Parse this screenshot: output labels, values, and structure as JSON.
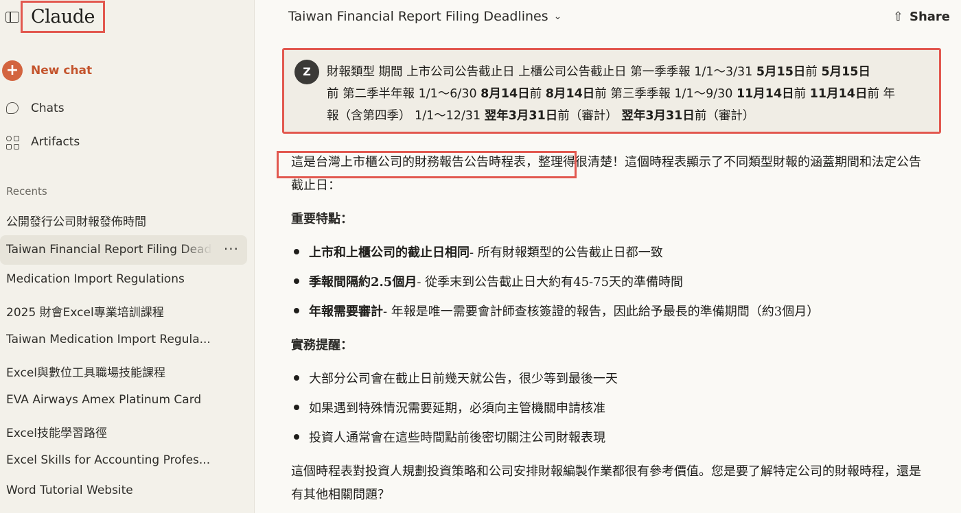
{
  "sidebar": {
    "brand": "Claude",
    "new_chat": "New chat",
    "nav": {
      "chats": "Chats",
      "artifacts": "Artifacts"
    },
    "recents_label": "Recents",
    "recents": [
      "公開發行公司財報發佈時間",
      "Taiwan Financial Report Filing Deadlines",
      "Medication Import Regulations",
      "2025 財會Excel專業培訓課程",
      "Taiwan Medication Import Regula...",
      "Excel與數位工具職場技能課程",
      "EVA Airways Amex Platinum Card",
      "Excel技能學習路徑",
      "Excel Skills for Accounting Profes...",
      "Word Tutorial Website"
    ],
    "active_more": "···"
  },
  "header": {
    "title": "Taiwan Financial Report Filing Deadlines",
    "share": "Share"
  },
  "user": {
    "avatar": "Z",
    "line1_a": "財報類型 期間 上市公司公告截止日 上櫃公司公告截止日 第一季季報 1/1～3/31 ",
    "line1_b1": "5月15日",
    "line1_c": "前 ",
    "line1_b2": "5月15日",
    "line2_a": "前 第二季半年報 1/1～6/30 ",
    "line2_b1": "8月14日",
    "line2_c": "前 ",
    "line2_b2": "8月14日",
    "line2_d": "前 第三季季報 1/1～9/30 ",
    "line2_b3": "11月14日",
    "line2_e": "前 ",
    "line2_b4": "11月14日",
    "line2_f": "前 年",
    "line3_a": "報（含第四季） 1/1～12/31 ",
    "line3_b1": "翌年3月31日",
    "line3_c": "前（審計） ",
    "line3_b2": "翌年3月31日",
    "line3_d": "前（審計）"
  },
  "response": {
    "para1": "這是台灣上市櫃公司的財務報告公告時程表，整理得很清楚！這個時程表顯示了不同類型財報的涵蓋期間和法定公告截止日：",
    "section1": "重要特點：",
    "bullets1": [
      {
        "bold": "上市和上櫃公司的截止日相同",
        "text": " - 所有財報類型的公告截止日都一致"
      },
      {
        "bold": "季報間隔約2.5個月",
        "text": " - 從季末到公告截止日大約有45-75天的準備時間"
      },
      {
        "bold": "年報需要審計",
        "text": " - 年報是唯一需要會計師查核簽證的報告，因此給予最長的準備期間（約3個月）"
      }
    ],
    "section2": "實務提醒：",
    "bullets2": [
      "大部分公司會在截止日前幾天就公告，很少等到最後一天",
      "如果遇到特殊情況需要延期，必須向主管機關申請核准",
      "投資人通常會在這些時間點前後密切關注公司財報表現"
    ],
    "para_final": "這個時程表對投資人規劃投資策略和公司安排財報編製作業都很有參考價值。您是要了解特定公司的財報時程，還是有其他相關問題？"
  }
}
